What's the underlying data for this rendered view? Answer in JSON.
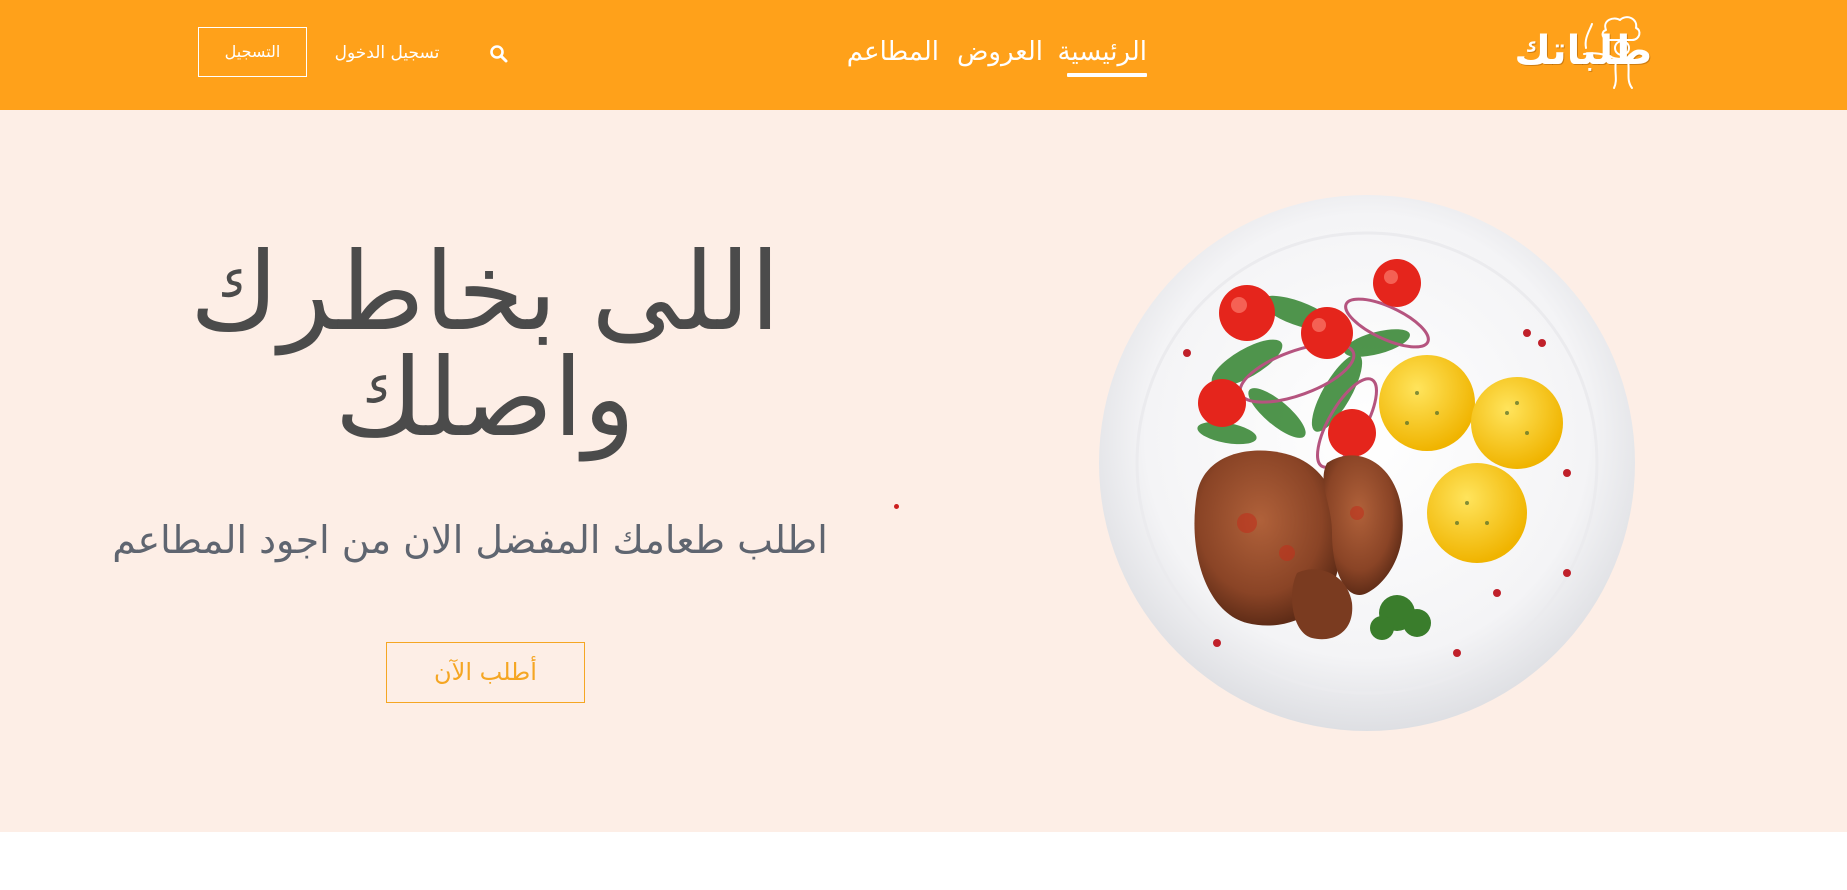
{
  "brand": {
    "logo_text": "طلباتك"
  },
  "nav": {
    "home": "الرئيسية",
    "offers": "العروض",
    "restaurants": "المطاعم",
    "login": "تسجيل الدخول",
    "register": "التسجيل"
  },
  "hero": {
    "title_line1": "اللى بخاطرك",
    "title_line2": "واصلك",
    "subtitle": "اطلب طعامك المفضل الان من اجود المطاعم",
    "cta": "أطلب الآن",
    "image": "grilled-meat-plate-with-salad-and-potatoes"
  },
  "colors": {
    "accent": "#ffa11a",
    "hero_bg": "#fdeee6",
    "heading": "#4b4b4b",
    "subtitle": "#5f6570",
    "cta": "#f5a623"
  },
  "icons": {
    "search": "search-icon",
    "chef": "chef-logo-icon"
  }
}
